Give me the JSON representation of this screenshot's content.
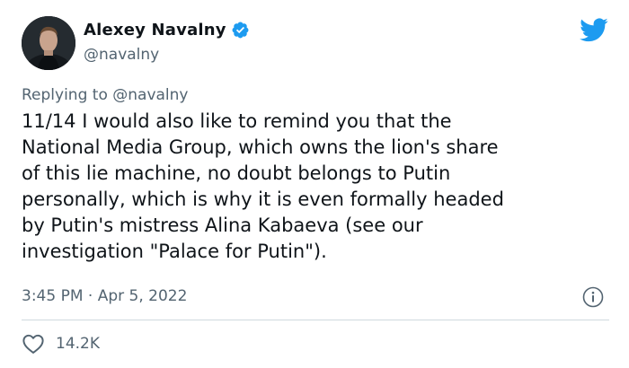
{
  "author": {
    "display_name": "Alexey Navalny",
    "handle": "@navalny",
    "verified": true,
    "avatar": "profile-photo"
  },
  "reply_context": {
    "prefix": "Replying to ",
    "mention": "@navalny"
  },
  "tweet": {
    "text": "11/14 I would also like to remind you that the\nNational Media Group, which owns the lion's share\nof this lie machine, no doubt belongs to Putin\npersonally, which is why it is even formally headed\nby Putin's mistress Alina Kabaeva (see our\ninvestigation \"Palace for Putin\").",
    "timestamp": "3:45 PM · Apr 5, 2022"
  },
  "engagement": {
    "likes": "14.2K"
  },
  "icons": {
    "brand": "twitter-bird-icon",
    "verified": "verified-badge-icon",
    "info": "info-icon",
    "like": "heart-icon"
  },
  "colors": {
    "brand_blue": "#1d9bf0",
    "text": "#0f1419",
    "secondary": "#536471",
    "divider": "#cfd9de"
  }
}
